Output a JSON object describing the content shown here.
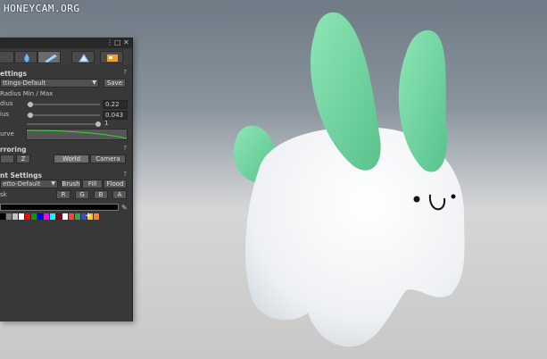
{
  "watermark": "HONEYCAM.ORG",
  "panel": {
    "settings_header": "ettings",
    "settings_dropdown": "ttings-Default",
    "save_label": "Save",
    "radius_header": "Radius Min / Max",
    "rows": [
      {
        "label": "dius",
        "value": "0.22",
        "level": 0.05
      },
      {
        "label": "ius",
        "value": "0.043",
        "level": 0.05
      },
      {
        "label": "",
        "value": "1",
        "level": 0.95
      }
    ],
    "curve_label": "urve",
    "mirroring_header": "rroring",
    "mirror_axis": "Z",
    "world_label": "World",
    "camera_label": "Camera",
    "paint_header": "nt Settings",
    "palette_dropdown": "etto-Default",
    "brush_label": "Brush",
    "fill_label": "Fill",
    "flood_label": "Flood",
    "mask_label": "sk",
    "channels": [
      "R",
      "G",
      "B",
      "A"
    ],
    "help_icon": "?",
    "palette_colors": [
      "#000000",
      "#7f7f7f",
      "#c3c3c3",
      "#ffffff",
      "#ff0000",
      "#00a000",
      "#0000ff",
      "#ff00ff",
      "#00ffff",
      "#880015",
      "#ffffff",
      "#ff4040",
      "#22b14c",
      "#3f48cc",
      "#ffc90e",
      "#ff7f27"
    ]
  },
  "colors": {
    "ear_green": "#6fd6a1",
    "body_white": "#f4f6f8",
    "panel_bg": "#383838"
  }
}
